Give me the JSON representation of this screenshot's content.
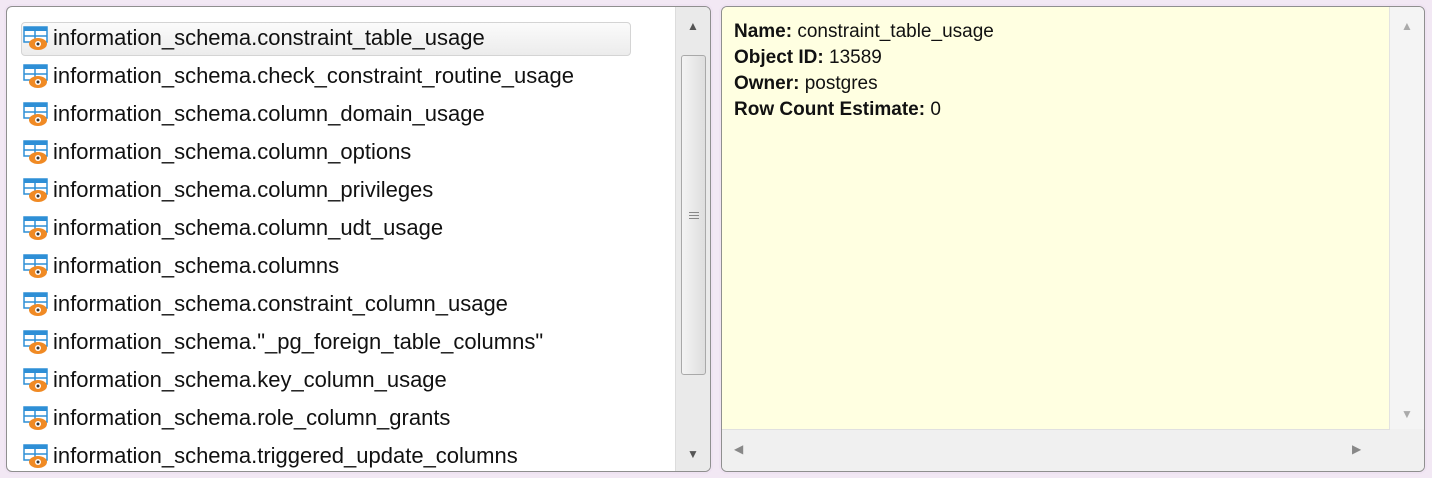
{
  "object_list": {
    "items": [
      {
        "label": "information_schema.constraint_table_usage",
        "selected": true
      },
      {
        "label": "information_schema.check_constraint_routine_usage",
        "selected": false
      },
      {
        "label": "information_schema.column_domain_usage",
        "selected": false
      },
      {
        "label": "information_schema.column_options",
        "selected": false
      },
      {
        "label": "information_schema.column_privileges",
        "selected": false
      },
      {
        "label": "information_schema.column_udt_usage",
        "selected": false
      },
      {
        "label": "information_schema.columns",
        "selected": false
      },
      {
        "label": "information_schema.constraint_column_usage",
        "selected": false
      },
      {
        "label": "information_schema.\"_pg_foreign_table_columns\"",
        "selected": false
      },
      {
        "label": "information_schema.key_column_usage",
        "selected": false
      },
      {
        "label": "information_schema.role_column_grants",
        "selected": false
      },
      {
        "label": "information_schema.triggered_update_columns",
        "selected": false
      }
    ],
    "item_icon": "view-icon"
  },
  "properties": {
    "name_label": "Name:",
    "name_value": "constraint_table_usage",
    "object_id_label": "Object ID:",
    "object_id_value": "13589",
    "owner_label": "Owner:",
    "owner_value": "postgres",
    "row_count_label": "Row Count Estimate:",
    "row_count_value": "0"
  },
  "colors": {
    "properties_background": "#ffffe1",
    "icon_blue": "#2e8fd6",
    "icon_orange": "#f08a24"
  }
}
